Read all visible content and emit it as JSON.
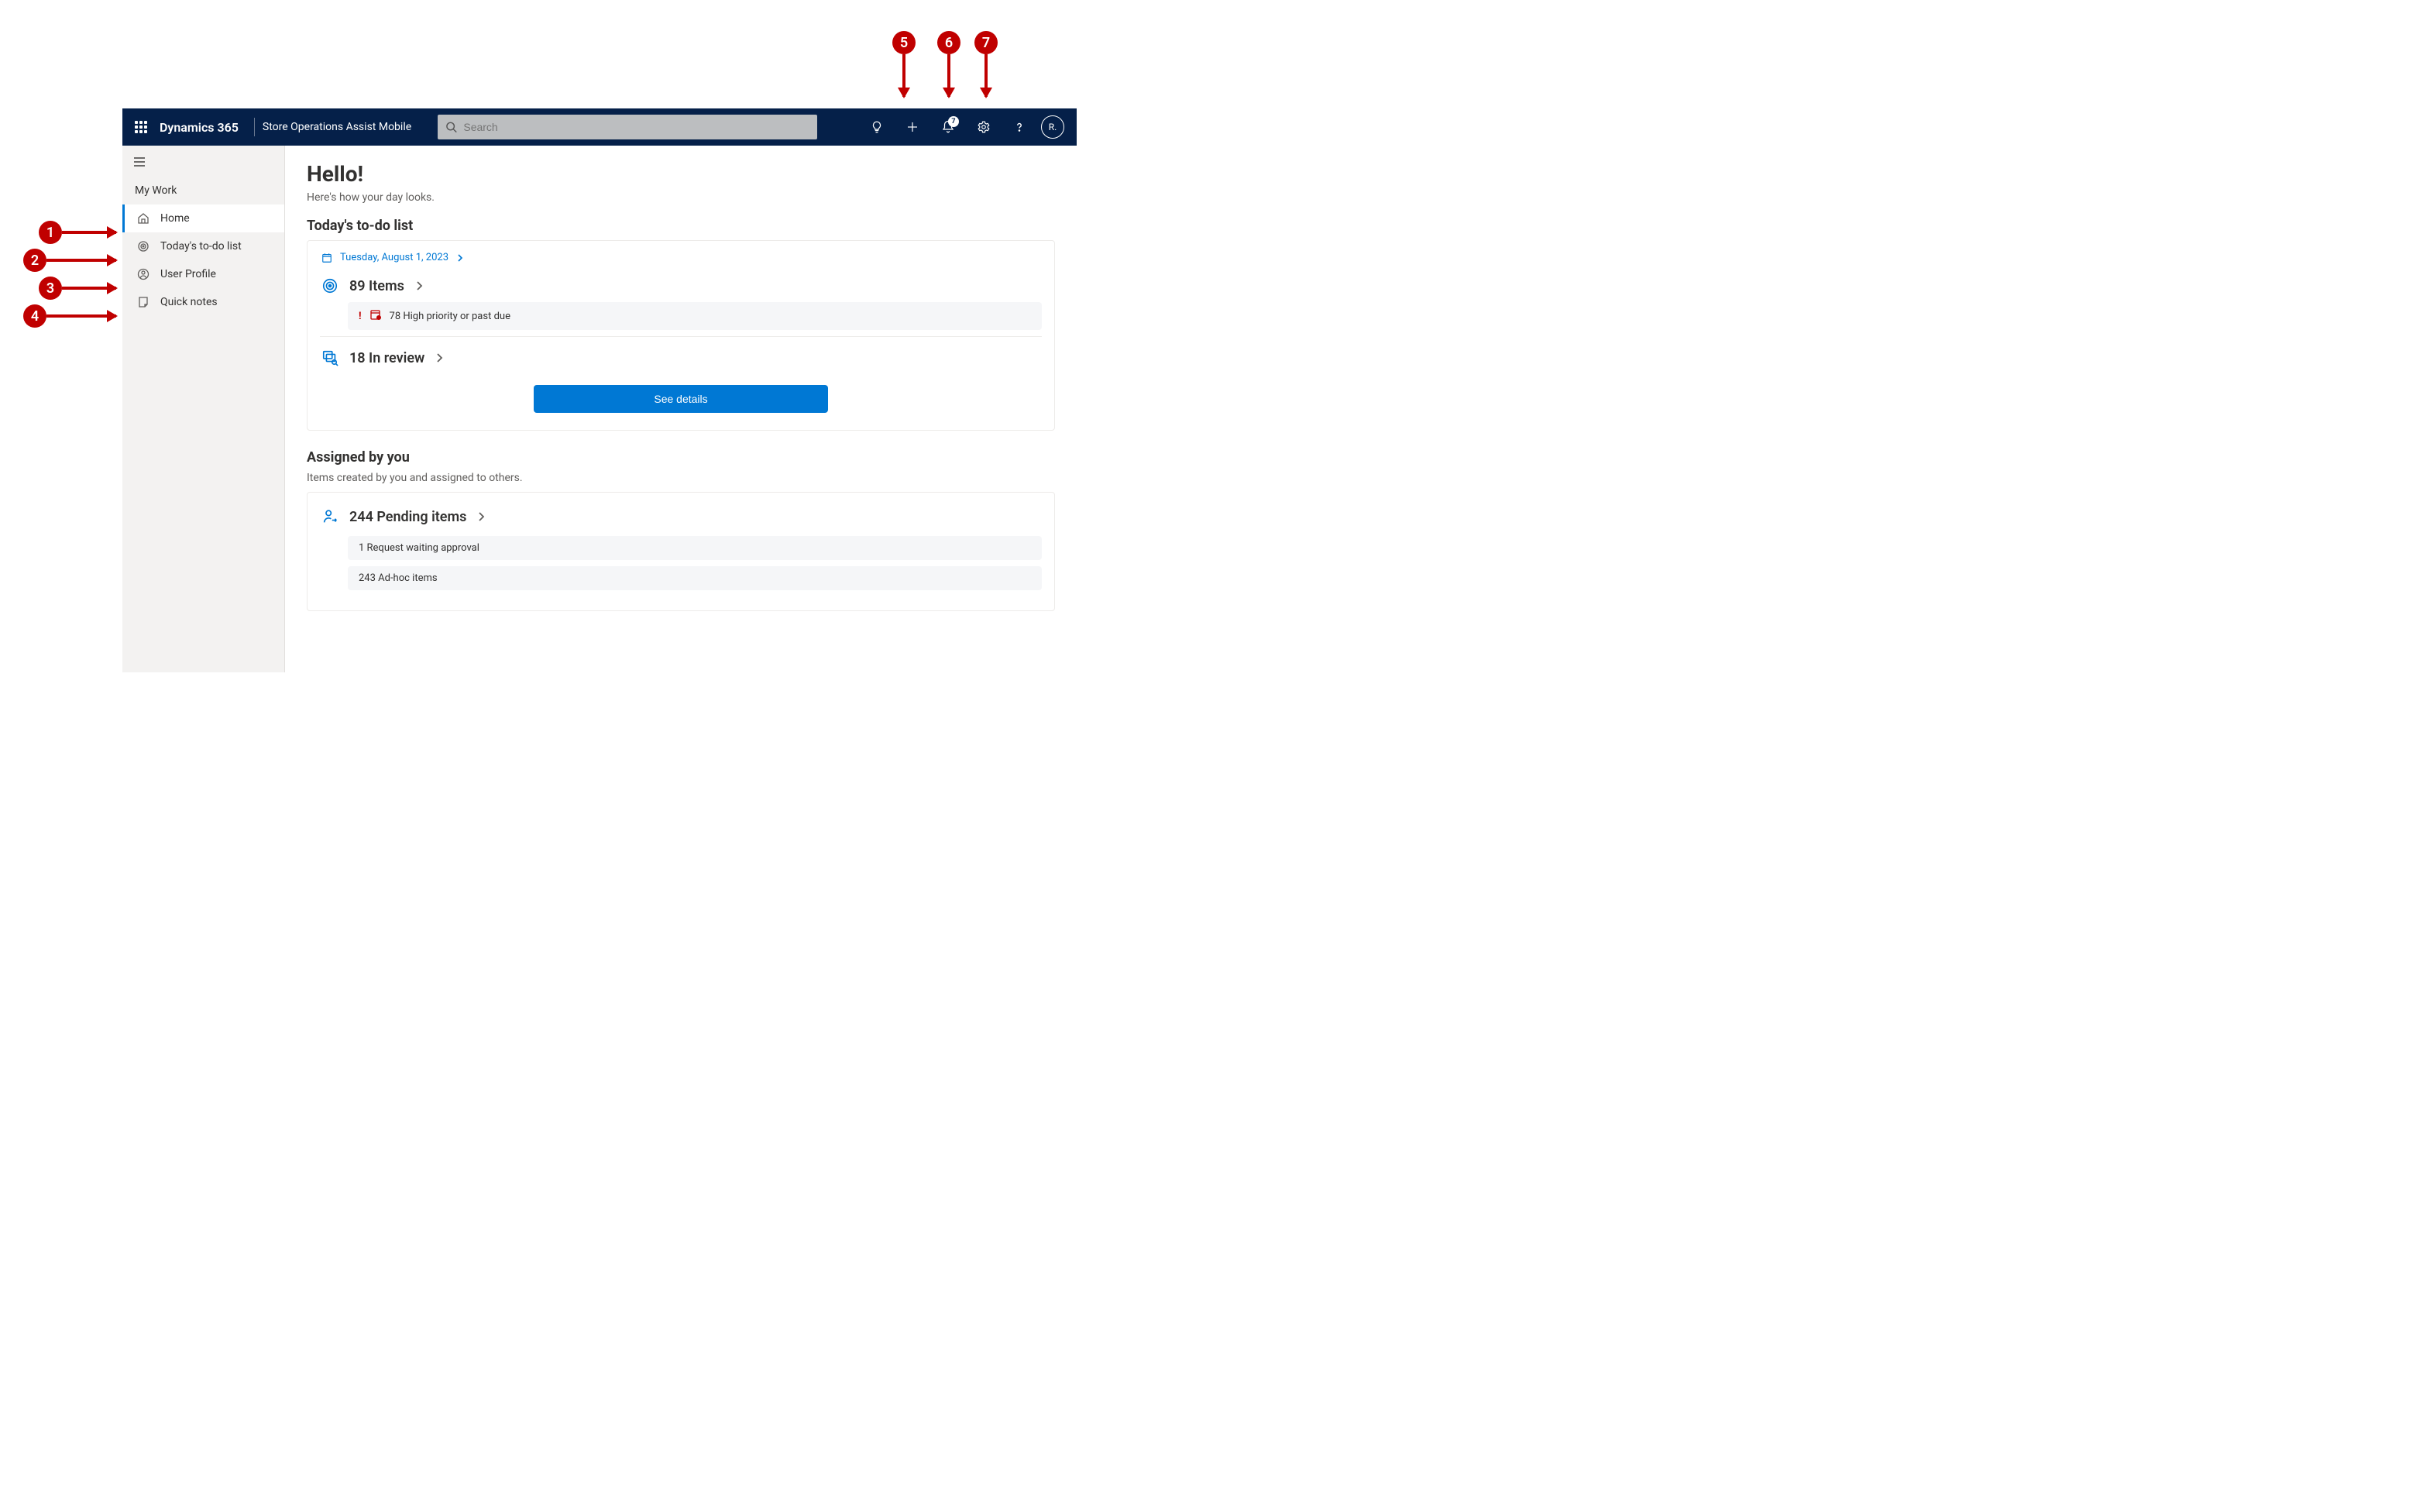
{
  "annotations": {
    "left": [
      "1",
      "2",
      "3",
      "4"
    ],
    "top": [
      "5",
      "6",
      "7"
    ]
  },
  "header": {
    "product": "Dynamics 365",
    "app_name": "Store Operations Assist Mobile",
    "search_placeholder": "Search",
    "notification_count": "7",
    "avatar_initials": "R."
  },
  "sidebar": {
    "section": "My Work",
    "items": [
      {
        "label": "Home",
        "active": true
      },
      {
        "label": "Today's to-do list",
        "active": false
      },
      {
        "label": "User Profile",
        "active": false
      },
      {
        "label": "Quick notes",
        "active": false
      }
    ]
  },
  "main": {
    "greeting": "Hello!",
    "greeting_sub": "Here's how your day looks.",
    "todo": {
      "title": "Today's to-do list",
      "date": "Tuesday, August 1, 2023",
      "items_label": "89 Items",
      "alert_text": "78 High priority or past due",
      "review_label": "18 In review",
      "button": "See details"
    },
    "assigned": {
      "title": "Assigned by you",
      "sub": "Items created by you and assigned to others.",
      "pending_label": "244 Pending items",
      "rows": [
        "1 Request waiting approval",
        "243 Ad-hoc items"
      ]
    }
  }
}
